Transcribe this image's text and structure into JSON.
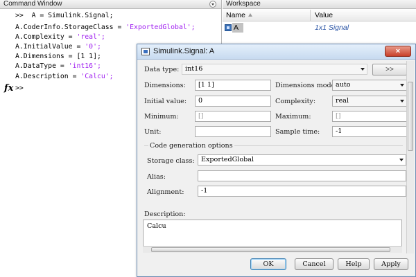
{
  "command_window": {
    "title": "Command Window",
    "prompt": ">>",
    "prompt_fx": "fx",
    "lines": [
      {
        "code": ">>  A = Simulink.Signal;",
        "str": ""
      },
      {
        "code": "A.CoderInfo.StorageClass = ",
        "str": "'ExportedGlobal';"
      },
      {
        "code": "A.Complexity = ",
        "str": "'real';"
      },
      {
        "code": "A.InitialValue = ",
        "str": "'0';"
      },
      {
        "code": "A.Dimensions = [1 1];",
        "str": ""
      },
      {
        "code": "A.DataType = ",
        "str": "'int16';"
      },
      {
        "code": "A.Description = ",
        "str": "'Calcu';"
      }
    ]
  },
  "workspace": {
    "title": "Workspace",
    "columns": {
      "name": "Name",
      "value": "Value"
    },
    "rows": [
      {
        "name": "A",
        "value": "1x1 Signal"
      }
    ]
  },
  "dialog": {
    "title": "Simulink.Signal: A",
    "close_label": "×",
    "data_type_label": "Data type:",
    "data_type_value": "int16",
    "data_type_button": ">>",
    "dimensions_label": "Dimensions:",
    "dimensions_value": "[1 1]",
    "dimensions_mode_label": "Dimensions mode:",
    "dimensions_mode_value": "auto",
    "initial_value_label": "Initial value:",
    "initial_value_value": "0",
    "complexity_label": "Complexity:",
    "complexity_value": "real",
    "minimum_label": "Minimum:",
    "minimum_value": "[]",
    "maximum_label": "Maximum:",
    "maximum_value": "[]",
    "unit_label": "Unit:",
    "unit_value": "",
    "sample_time_label": "Sample time:",
    "sample_time_value": "-1",
    "codegen_group_label": "Code generation options",
    "storage_class_label": "Storage class:",
    "storage_class_value": "ExportedGlobal",
    "alias_label": "Alias:",
    "alias_value": "",
    "alignment_label": "Alignment:",
    "alignment_value": "-1",
    "description_label": "Description:",
    "description_value": "Calcu",
    "buttons": {
      "ok": "OK",
      "cancel": "Cancel",
      "help": "Help",
      "apply": "Apply"
    }
  }
}
